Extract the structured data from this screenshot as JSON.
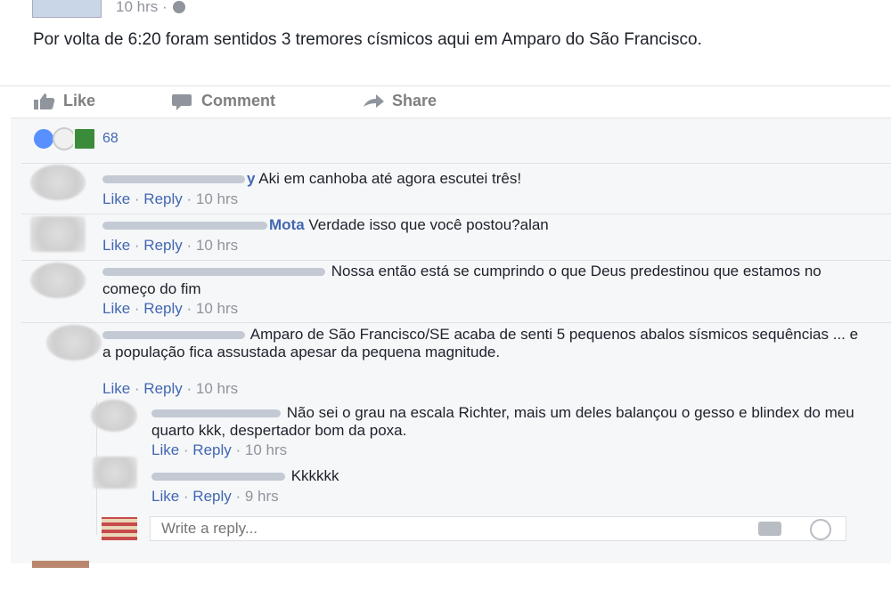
{
  "post": {
    "timestamp": "10 hrs ·",
    "text": "Por volta de 6:20 foram sentidos 3 tremores císmicos aqui em Amparo do São Francisco."
  },
  "actions": {
    "like": "Like",
    "comment": "Comment",
    "share": "Share"
  },
  "reactions": {
    "count": "68"
  },
  "comments": [
    {
      "name_tail": "y",
      "text": " Aki em canhoba até agora escutei três!",
      "like": "Like",
      "reply": "Reply",
      "time": "10 hrs"
    },
    {
      "name_tail": "Mota",
      "text": " Verdade isso que você postou?alan",
      "like": "Like",
      "reply": "Reply",
      "time": "10 hrs"
    },
    {
      "name_tail": "",
      "text": " Nossa então está se cumprindo o que Deus predestinou que estamos no começo do fim",
      "like": "Like",
      "reply": "Reply",
      "time": "10 hrs"
    },
    {
      "name_tail": "",
      "text": " Amparo de São Francisco/SE acaba de senti 5 pequenos abalos sísmicos sequências ... e a população fica assustada apesar da pequena magnitude.",
      "like": "Like",
      "reply": "Reply",
      "time": "10 hrs"
    }
  ],
  "replies": [
    {
      "text": " Não sei o grau na escala Richter, mais um deles balançou o gesso e blindex do meu quarto kkk, despertador bom da poxa.",
      "like": "Like",
      "reply": "Reply",
      "time": "10 hrs"
    },
    {
      "text": " Kkkkkk",
      "like": "Like",
      "reply": "Reply",
      "time": "9 hrs"
    }
  ],
  "reply_box": {
    "placeholder": "Write a reply..."
  },
  "icons": [
    "globe-icon",
    "like-thumb-icon",
    "comment-bubble-icon",
    "share-arrow-icon",
    "camera-icon",
    "emoji-icon"
  ],
  "colors": {
    "link": "#4267b2",
    "meta": "#90949c",
    "action": "#7f7f7f",
    "background": "#f6f7f9"
  }
}
